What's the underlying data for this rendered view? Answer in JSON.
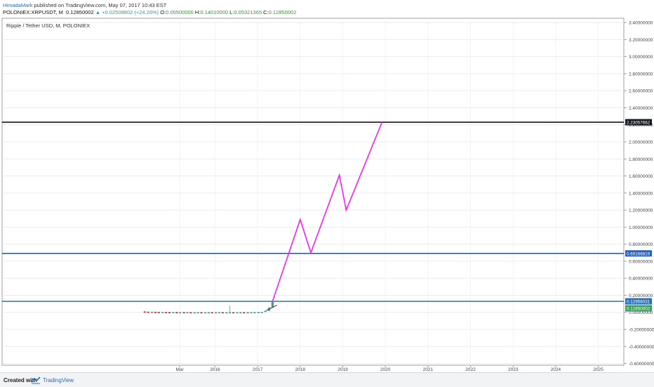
{
  "header": {
    "author": "HimadaMark",
    "published_text": "published on TradingView.com, May 07, 2017 10:43 EST",
    "symbol_line": "POLONIEX:XRPUSDT, M",
    "price": "0.12850002",
    "arrow": "▲",
    "change": "+0.02508802 (+24.26%)",
    "o_label": "O:",
    "o_value": "0.05500000",
    "h_label": "H:",
    "h_value": "0.14010000",
    "l_label": "L:",
    "l_value": "0.05321365",
    "c_label": "C:",
    "c_value": "0.12850002"
  },
  "chart_title": "Ripple / Tether USD, M, POLONIEX",
  "footer": {
    "created_with": "Created with",
    "brand": "TradingView"
  },
  "colors": {
    "projection": "#ff1aff",
    "blue_level": "#2b5fb0",
    "teal_level": "#3d7fa0",
    "black_level": "#000000",
    "candle_up": "#26a69a",
    "candle_down": "#c62828",
    "label_black": "#131722",
    "label_blue": "#2b5fb0",
    "label_teal": "#2a6db8",
    "label_green": "#3a9e5a"
  },
  "chart_data": {
    "type": "line",
    "title": "Ripple / Tether USD, M, POLONIEX",
    "y_axis": {
      "range": [
        -0.62,
        3.45
      ],
      "ticks": [
        "3.40000000",
        "3.20000000",
        "3.00000000",
        "2.80000000",
        "2.60000000",
        "2.40000000",
        "2.20000000",
        "2.00000000",
        "1.80000000",
        "1.60000000",
        "1.40000000",
        "1.20000000",
        "1.00000000",
        "0.80000000",
        "0.60000000",
        "0.40000000",
        "0.20000000",
        "0.00000000",
        "-0.20000000",
        "-0.40000000",
        "-0.60000000"
      ],
      "tick_values": [
        3.4,
        3.2,
        3.0,
        2.8,
        2.6,
        2.4,
        2.2,
        2.0,
        1.8,
        1.6,
        1.4,
        1.2,
        1.0,
        0.8,
        0.6,
        0.4,
        0.2,
        0.0,
        -0.2,
        -0.4,
        -0.6
      ]
    },
    "x_axis": {
      "range": [
        2011.0,
        2025.6
      ],
      "ticks": [
        "Mar",
        "2016",
        "2017",
        "2018",
        "2019",
        "2020",
        "2021",
        "2022",
        "2023",
        "2024",
        "2025"
      ],
      "tick_values": [
        2015.17,
        2016.0,
        2017.0,
        2018.0,
        2019.0,
        2020.0,
        2021.0,
        2022.0,
        2023.0,
        2024.0,
        2025.0
      ]
    },
    "grid": true,
    "horizontal_levels": [
      {
        "value": 2.23057662,
        "label": "2.23057662",
        "color": "#000000",
        "label_bg": "#131722"
      },
      {
        "value": 0.69166819,
        "label": "0.69166819",
        "color": "#2b5fb0",
        "label_bg": "#2b5fb0"
      },
      {
        "value": 0.12956031,
        "label": "0.12956031",
        "color": "#3d7fa0",
        "label_bg": "#2a6db8"
      },
      {
        "value": 0.12850002,
        "label": "0.12850002",
        "color": "#3d7fa0",
        "label_bg": "#3a9e5a"
      }
    ],
    "projection_path": [
      {
        "x": 2017.35,
        "y": 0.13
      },
      {
        "x": 2018.0,
        "y": 1.09
      },
      {
        "x": 2018.25,
        "y": 0.7
      },
      {
        "x": 2018.92,
        "y": 1.61
      },
      {
        "x": 2019.08,
        "y": 1.2
      },
      {
        "x": 2019.92,
        "y": 2.23
      }
    ],
    "secondary_path": [
      {
        "x": 2017.2,
        "y": 0.02
      },
      {
        "x": 2017.45,
        "y": 0.085
      }
    ],
    "candles": [
      {
        "x": 2014.35,
        "o": 0.01,
        "c": 0.004,
        "h": 0.012,
        "l": 0.003
      },
      {
        "x": 2014.43,
        "o": 0.007,
        "c": 0.003,
        "h": 0.009,
        "l": 0.002
      },
      {
        "x": 2014.52,
        "o": 0.005,
        "c": 0.006,
        "h": 0.008,
        "l": 0.004
      },
      {
        "x": 2014.6,
        "o": 0.006,
        "c": 0.005,
        "h": 0.007,
        "l": 0.004
      },
      {
        "x": 2014.68,
        "o": 0.005,
        "c": 0.004,
        "h": 0.006,
        "l": 0.003
      },
      {
        "x": 2014.77,
        "o": 0.004,
        "c": 0.004,
        "h": 0.005,
        "l": 0.003
      },
      {
        "x": 2014.85,
        "o": 0.004,
        "c": 0.003,
        "h": 0.005,
        "l": 0.002
      },
      {
        "x": 2014.93,
        "o": 0.003,
        "c": 0.002,
        "h": 0.004,
        "l": 0.001
      },
      {
        "x": 2015.02,
        "o": 0.002,
        "c": 0.003,
        "h": 0.004,
        "l": 0.001
      },
      {
        "x": 2015.1,
        "o": 0.003,
        "c": 0.002,
        "h": 0.004,
        "l": 0.001
      },
      {
        "x": 2015.18,
        "o": 0.002,
        "c": 0.002,
        "h": 0.003,
        "l": 0.001
      },
      {
        "x": 2015.27,
        "o": 0.002,
        "c": 0.001,
        "h": 0.003,
        "l": 0.001
      },
      {
        "x": 2015.35,
        "o": 0.001,
        "c": 0.002,
        "h": 0.003,
        "l": 0.001
      },
      {
        "x": 2015.43,
        "o": 0.002,
        "c": 0.001,
        "h": 0.003,
        "l": 0.001
      },
      {
        "x": 2015.52,
        "o": 0.001,
        "c": 0.001,
        "h": 0.002,
        "l": 0.0
      },
      {
        "x": 2015.6,
        "o": 0.001,
        "c": 0.002,
        "h": 0.003,
        "l": 0.001
      },
      {
        "x": 2015.68,
        "o": 0.002,
        "c": 0.001,
        "h": 0.003,
        "l": 0.001
      },
      {
        "x": 2015.77,
        "o": 0.001,
        "c": 0.001,
        "h": 0.002,
        "l": 0.0
      },
      {
        "x": 2015.85,
        "o": 0.001,
        "c": 0.002,
        "h": 0.003,
        "l": 0.001
      },
      {
        "x": 2015.93,
        "o": 0.002,
        "c": 0.001,
        "h": 0.003,
        "l": 0.001
      },
      {
        "x": 2016.02,
        "o": 0.001,
        "c": 0.001,
        "h": 0.002,
        "l": 0.0
      },
      {
        "x": 2016.1,
        "o": 0.001,
        "c": 0.002,
        "h": 0.003,
        "l": 0.001
      },
      {
        "x": 2016.18,
        "o": 0.002,
        "c": 0.001,
        "h": 0.003,
        "l": 0.001
      },
      {
        "x": 2016.27,
        "o": 0.001,
        "c": 0.002,
        "h": 0.004,
        "l": 0.001
      },
      {
        "x": 2016.35,
        "o": 0.002,
        "c": 0.002,
        "h": 0.08,
        "l": 0.001
      },
      {
        "x": 2016.43,
        "o": 0.002,
        "c": 0.001,
        "h": 0.003,
        "l": 0.001
      },
      {
        "x": 2016.52,
        "o": 0.001,
        "c": 0.002,
        "h": 0.003,
        "l": 0.001
      },
      {
        "x": 2016.6,
        "o": 0.002,
        "c": 0.002,
        "h": 0.003,
        "l": 0.001
      },
      {
        "x": 2016.68,
        "o": 0.002,
        "c": 0.001,
        "h": 0.003,
        "l": 0.001
      },
      {
        "x": 2016.77,
        "o": 0.001,
        "c": 0.002,
        "h": 0.003,
        "l": 0.001
      },
      {
        "x": 2016.85,
        "o": 0.002,
        "c": 0.002,
        "h": 0.003,
        "l": 0.001
      },
      {
        "x": 2016.93,
        "o": 0.002,
        "c": 0.003,
        "h": 0.004,
        "l": 0.002
      },
      {
        "x": 2017.02,
        "o": 0.003,
        "c": 0.004,
        "h": 0.005,
        "l": 0.002
      },
      {
        "x": 2017.1,
        "o": 0.004,
        "c": 0.005,
        "h": 0.006,
        "l": 0.003
      },
      {
        "x": 2017.18,
        "o": 0.005,
        "c": 0.018,
        "h": 0.02,
        "l": 0.004
      },
      {
        "x": 2017.27,
        "o": 0.018,
        "c": 0.055,
        "h": 0.06,
        "l": 0.017
      },
      {
        "x": 2017.35,
        "o": 0.055,
        "c": 0.1285,
        "h": 0.1401,
        "l": 0.0532
      }
    ]
  }
}
